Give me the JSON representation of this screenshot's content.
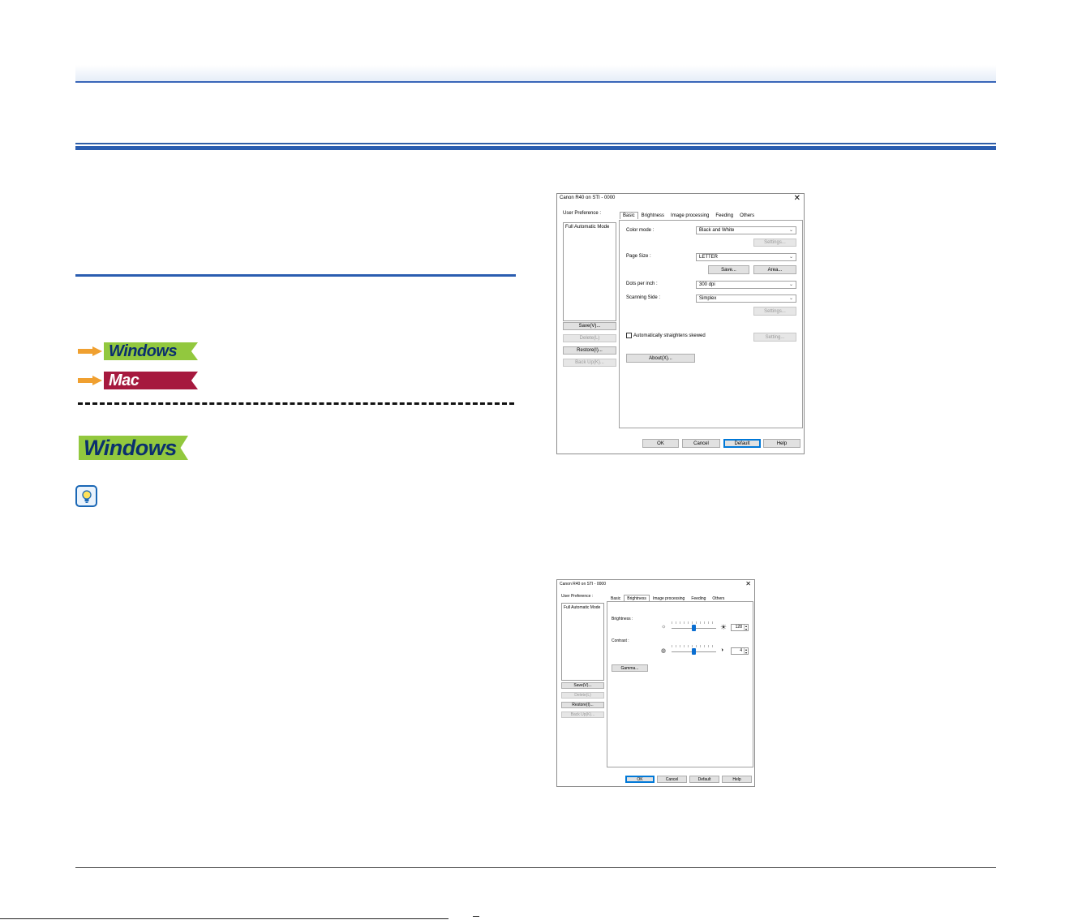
{
  "os_links": {
    "windows_label": "Windows",
    "mac_label": "Mac"
  },
  "windows_heading": {
    "badge_label": "Windows"
  },
  "colors": {
    "rule_blue": "#2a5db0",
    "windows_badge": "#92c83e",
    "mac_badge": "#a6193e",
    "arrow_orange": "#f0a030"
  },
  "icons": [
    "arrow-right-icon",
    "lightbulb-hint-icon",
    "close-icon",
    "chevron-down-icon",
    "sun-dim-icon",
    "sun-bright-icon",
    "contrast-low-icon",
    "contrast-high-icon"
  ],
  "dialog_basic": {
    "title": "Canon R40 on STI - 0000",
    "close_symbol": "✕",
    "user_preference_label": "User Preference :",
    "preference_items": [
      "Full Automatic Mode"
    ],
    "side_buttons": {
      "save": "Save(V)...",
      "delete": "Delete(L)",
      "restore": "Restore(I)...",
      "backup": "Back Up(K)..."
    },
    "tabs": [
      "Basic",
      "Brightness",
      "Image processing",
      "Feeding",
      "Others"
    ],
    "active_tab": "Basic",
    "color_mode": {
      "label": "Color mode :",
      "value": "Black and White",
      "settings": "Settings..."
    },
    "page_size": {
      "label": "Page Size :",
      "value": "LETTER",
      "save": "Save...",
      "area": "Area..."
    },
    "dots_per_inch": {
      "label": "Dots per inch :",
      "value": "300 dpi"
    },
    "scanning_side": {
      "label": "Scanning Side :",
      "value": "Simplex",
      "settings": "Settings..."
    },
    "auto_straighten": {
      "label": "Automatically straightens skewed",
      "checked": false,
      "setting": "Setting..."
    },
    "about": "About(X)...",
    "footer_buttons": {
      "ok": "OK",
      "cancel": "Cancel",
      "default": "Default",
      "help": "Help"
    }
  },
  "dialog_brightness": {
    "title": "Canon R40 on STI - 0000",
    "close_symbol": "✕",
    "user_preference_label": "User Preference :",
    "preference_items": [
      "Full Automatic Mode"
    ],
    "side_buttons": {
      "save": "Save(V)...",
      "delete": "Delete(L)",
      "restore": "Restore(I)...",
      "backup": "Back Up(K)..."
    },
    "tabs": [
      "Basic",
      "Brightness",
      "Image processing",
      "Feeding",
      "Others"
    ],
    "active_tab": "Brightness",
    "brightness": {
      "label": "Brightness :",
      "value": "128",
      "level": 0.5
    },
    "contrast": {
      "label": "Contrast :",
      "value": "4",
      "level": 0.5
    },
    "gamma": "Gamma...",
    "footer_buttons": {
      "ok": "OK",
      "cancel": "Cancel",
      "default": "Default",
      "help": "Help"
    }
  }
}
